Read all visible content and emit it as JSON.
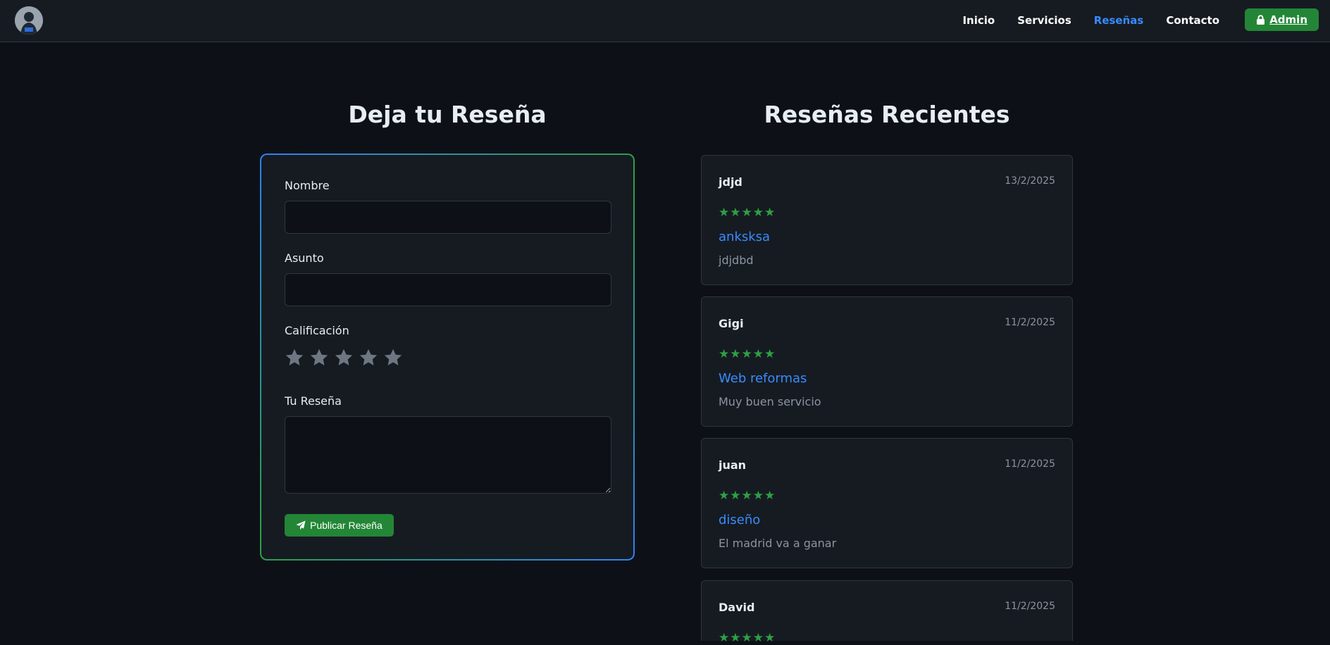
{
  "nav": {
    "links": [
      {
        "label": "Inicio"
      },
      {
        "label": "Servicios"
      },
      {
        "label": "Reseñas"
      },
      {
        "label": "Contacto"
      }
    ],
    "active_link": "Reseñas",
    "admin_label": "Admin",
    "admin_icon": "lock-icon"
  },
  "form_section": {
    "title": "Deja tu Reseña",
    "name_label": "Nombre",
    "name_value": "",
    "subject_label": "Asunto",
    "subject_value": "",
    "rating_label": "Calificación",
    "rating_value": 0,
    "rating_max": 5,
    "review_label": "Tu Reseña",
    "review_value": "",
    "submit_label": "Publicar Reseña",
    "submit_icon": "paper-plane-icon"
  },
  "reviews_section": {
    "title": "Reseñas Recientes",
    "reviews": [
      {
        "name": "jdjd",
        "date": "13/2/2025",
        "stars": "★★★★★",
        "rating": 5,
        "subject": "anksksa",
        "text": "jdjdbd"
      },
      {
        "name": "Gigi",
        "date": "11/2/2025",
        "stars": "★★★★★",
        "rating": 5,
        "subject": "Web reformas",
        "text": "Muy buen servicio"
      },
      {
        "name": "juan",
        "date": "11/2/2025",
        "stars": "★★★★★",
        "rating": 5,
        "subject": "diseño",
        "text": "El madrid va a ganar"
      },
      {
        "name": "David",
        "date": "11/2/2025",
        "stars": "★★★★★",
        "rating": 5,
        "subject": "",
        "text": ""
      }
    ]
  },
  "colors": {
    "background": "#0d1117",
    "surface": "#161b22",
    "accent_blue": "#388bfd",
    "accent_green": "#238636",
    "star_green": "#2ea043",
    "star_empty": "#6e7681"
  }
}
